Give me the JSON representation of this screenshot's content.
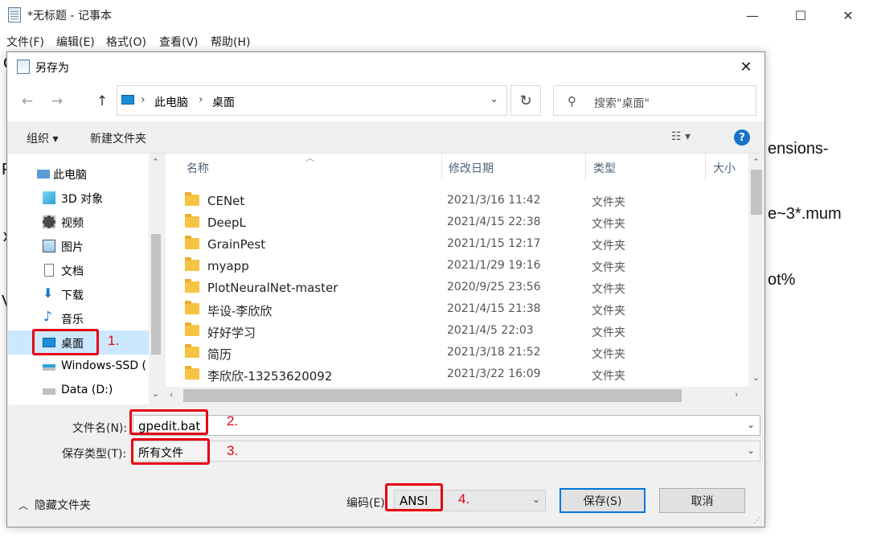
{
  "notepad": {
    "title": "*无标题 - 记事本",
    "minimize_label": "—",
    "maximize_label": "☐",
    "close_label": "✕",
    "menu": [
      "文件(F)",
      "编辑(E)",
      "格式(O)",
      "查看(V)",
      "帮助(H)"
    ],
    "text_fragments": [
      "C",
      "ensions-",
      "P",
      "e~3*.mum",
      "x",
      "ot%",
      "V"
    ]
  },
  "dialog": {
    "title": "另存为",
    "close_label": "✕",
    "nav": {
      "back": "←",
      "forward": "→",
      "up": "↑"
    },
    "address": {
      "items": [
        "此电脑",
        "桌面"
      ],
      "separator": "›",
      "dropdown": "⌄"
    },
    "refresh": "↻",
    "search": {
      "placeholder": "搜索\"桌面\""
    },
    "toolbar": {
      "organize": "组织 ▾",
      "new_folder": "新建文件夹",
      "view_icon": "☷ ▾",
      "help": "?"
    },
    "nav_pane": [
      {
        "label": "此电脑",
        "icon": "computer-icon"
      },
      {
        "label": "3D 对象",
        "icon": "3d-objects-icon"
      },
      {
        "label": "视频",
        "icon": "video-icon"
      },
      {
        "label": "图片",
        "icon": "pictures-icon"
      },
      {
        "label": "文档",
        "icon": "documents-icon"
      },
      {
        "label": "下载",
        "icon": "download-icon"
      },
      {
        "label": "音乐",
        "icon": "music-icon"
      },
      {
        "label": "桌面",
        "icon": "desktop-icon",
        "selected": true
      },
      {
        "label": "Windows-SSD (",
        "icon": "drive-icon"
      },
      {
        "label": "Data (D:)",
        "icon": "drive-icon"
      }
    ],
    "columns": [
      "名称",
      "修改日期",
      "类型",
      "大小"
    ],
    "files": [
      {
        "name": "CENet",
        "date": "2021/3/16 11:42",
        "type": "文件夹"
      },
      {
        "name": "DeepL",
        "date": "2021/4/15 22:38",
        "type": "文件夹"
      },
      {
        "name": "GrainPest",
        "date": "2021/1/15 12:17",
        "type": "文件夹"
      },
      {
        "name": "myapp",
        "date": "2021/1/29 19:16",
        "type": "文件夹"
      },
      {
        "name": "PlotNeuralNet-master",
        "date": "2020/9/25 23:56",
        "type": "文件夹"
      },
      {
        "name": "毕设-李欣欣",
        "date": "2021/4/15 21:38",
        "type": "文件夹"
      },
      {
        "name": "好好学习",
        "date": "2021/4/5 22:03",
        "type": "文件夹"
      },
      {
        "name": "简历",
        "date": "2021/3/18 21:52",
        "type": "文件夹"
      },
      {
        "name": "李欣欣-13253620092",
        "date": "2021/3/22 16:09",
        "type": "文件夹"
      }
    ],
    "filename": {
      "label": "文件名(N):",
      "value": "gpedit.bat"
    },
    "filetype": {
      "label": "保存类型(T):",
      "value": "所有文件"
    },
    "hide_folders": "隐藏文件夹",
    "encoding": {
      "label": "编码(E):",
      "value": "ANSI"
    },
    "save_button": "保存(S)",
    "cancel_button": "取消"
  },
  "annotations": [
    "1.",
    "2.",
    "3.",
    "4."
  ],
  "colors": {
    "selection": "#cce8ff",
    "annotation_red": "#e60012",
    "accent": "#0078d7"
  }
}
